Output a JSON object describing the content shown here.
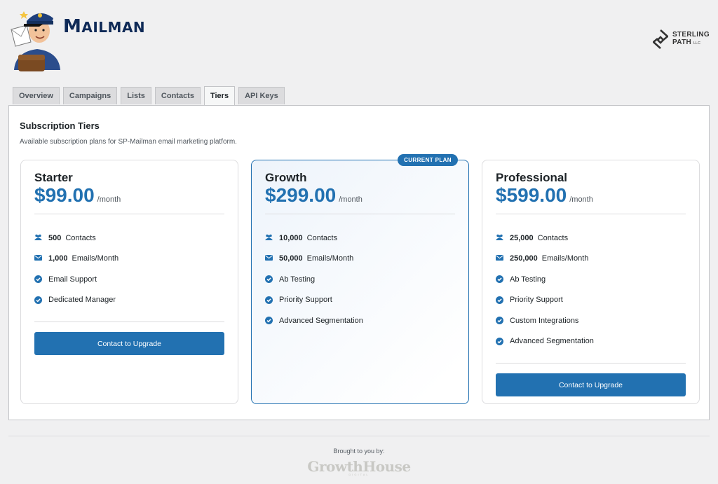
{
  "header": {
    "brand": {
      "first": "M",
      "rest": "AILMAN"
    },
    "partner": {
      "line1": "STERLING",
      "line2": "PATH",
      "suffix": "LLC"
    }
  },
  "tabs": [
    {
      "label": "Overview",
      "active": false
    },
    {
      "label": "Campaigns",
      "active": false
    },
    {
      "label": "Lists",
      "active": false
    },
    {
      "label": "Contacts",
      "active": false
    },
    {
      "label": "Tiers",
      "active": true
    },
    {
      "label": "API Keys",
      "active": false
    }
  ],
  "panel": {
    "title": "Subscription Tiers",
    "description": "Available subscription plans for SP-Mailman email marketing platform."
  },
  "tiers": [
    {
      "name": "Starter",
      "price": "$99.00",
      "period": "/month",
      "current": false,
      "features": [
        {
          "icon": "users-icon",
          "value": "500",
          "label": "Contacts"
        },
        {
          "icon": "envelope-icon",
          "value": "1,000",
          "label": "Emails/Month"
        },
        {
          "icon": "check-icon",
          "value": "",
          "label": "Email Support"
        },
        {
          "icon": "check-icon",
          "value": "",
          "label": "Dedicated Manager"
        }
      ],
      "button": "Contact to Upgrade"
    },
    {
      "name": "Growth",
      "price": "$299.00",
      "period": "/month",
      "current": true,
      "badge": "CURRENT PLAN",
      "features": [
        {
          "icon": "users-icon",
          "value": "10,000",
          "label": "Contacts"
        },
        {
          "icon": "envelope-icon",
          "value": "50,000",
          "label": "Emails/Month"
        },
        {
          "icon": "check-icon",
          "value": "",
          "label": "Ab Testing"
        },
        {
          "icon": "check-icon",
          "value": "",
          "label": "Priority Support"
        },
        {
          "icon": "check-icon",
          "value": "",
          "label": "Advanced Segmentation"
        }
      ],
      "button": ""
    },
    {
      "name": "Professional",
      "price": "$599.00",
      "period": "/month",
      "current": false,
      "features": [
        {
          "icon": "users-icon",
          "value": "25,000",
          "label": "Contacts"
        },
        {
          "icon": "envelope-icon",
          "value": "250,000",
          "label": "Emails/Month"
        },
        {
          "icon": "check-icon",
          "value": "",
          "label": "Ab Testing"
        },
        {
          "icon": "check-icon",
          "value": "",
          "label": "Priority Support"
        },
        {
          "icon": "check-icon",
          "value": "",
          "label": "Custom Integrations"
        },
        {
          "icon": "check-icon",
          "value": "",
          "label": "Advanced Segmentation"
        }
      ],
      "button": "Contact to Upgrade"
    }
  ],
  "footer": {
    "label": "Brought to you by:",
    "sponsor": "GrowthHouse",
    "sponsor_sub": "DIGITAL"
  },
  "colors": {
    "accent": "#2271b1",
    "brand": "#0f2a57"
  }
}
